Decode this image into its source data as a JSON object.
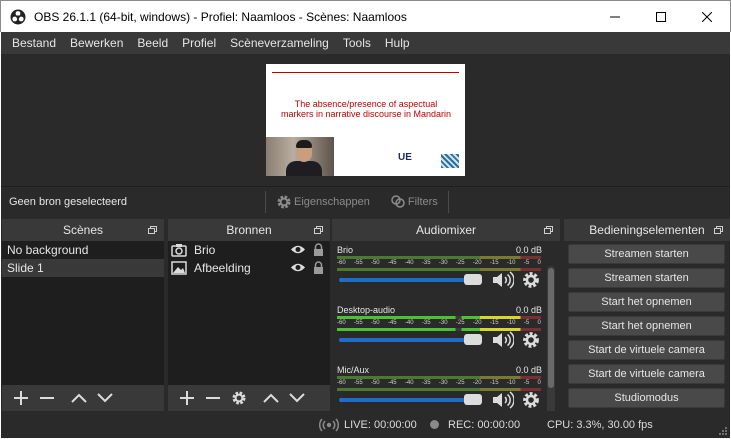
{
  "window": {
    "title": "OBS 26.1.1 (64-bit, windows) - Profiel: Naamloos - Scènes: Naamloos",
    "icon": "obs-logo-icon"
  },
  "menu": [
    "Bestand",
    "Bewerken",
    "Beeld",
    "Profiel",
    "Scèneverzameling",
    "Tools",
    "Hulp"
  ],
  "preview": {
    "slide_title": "The absence/presence of aspectual markers in narrative discourse in Mandarin",
    "logo_text": "UE"
  },
  "source_toolbar": {
    "no_source": "Geen bron geselecteerd",
    "properties": "Eigenschappen",
    "filters": "Filters"
  },
  "scenes": {
    "title": "Scènes",
    "items": [
      "No background",
      "Slide 1"
    ],
    "selected_index": 1
  },
  "sources": {
    "title": "Bronnen",
    "items": [
      {
        "label": "Brio",
        "icon": "camera-icon"
      },
      {
        "label": "Afbeelding",
        "icon": "image-icon"
      }
    ]
  },
  "mixer": {
    "title": "Audiomixer",
    "ticks": [
      "-60",
      "-55",
      "-50",
      "-45",
      "-40",
      "-35",
      "-30",
      "-25",
      "-20",
      "-15",
      "-10",
      "-5",
      "0"
    ],
    "channels": [
      {
        "name": "Brio",
        "db": "0.0 dB",
        "volume": 1.0
      },
      {
        "name": "Desktop-audio",
        "db": "0.0 dB",
        "volume": 1.0
      },
      {
        "name": "Mic/Aux",
        "db": "0.0 dB",
        "volume": 1.0
      }
    ]
  },
  "controls": {
    "title": "Bedieningselementen",
    "buttons": [
      "Streamen starten",
      "Streamen starten",
      "Start het opnemen",
      "Start het opnemen",
      "Start de virtuele camera",
      "Start de virtuele camera",
      "Studiomodus"
    ]
  },
  "status": {
    "live": "LIVE: 00:00:00",
    "rec": "REC: 00:00:00",
    "cpu": "CPU: 3.3%, 30.00 fps"
  },
  "colors": {
    "background": "#2b2a2b",
    "panel_header": "#3a393a",
    "list_bg": "#1f1e1f",
    "slider": "#1e6ec8",
    "meter_green": "#4dc231",
    "meter_yellow": "#d8d82a",
    "slide_red": "#c00000"
  }
}
